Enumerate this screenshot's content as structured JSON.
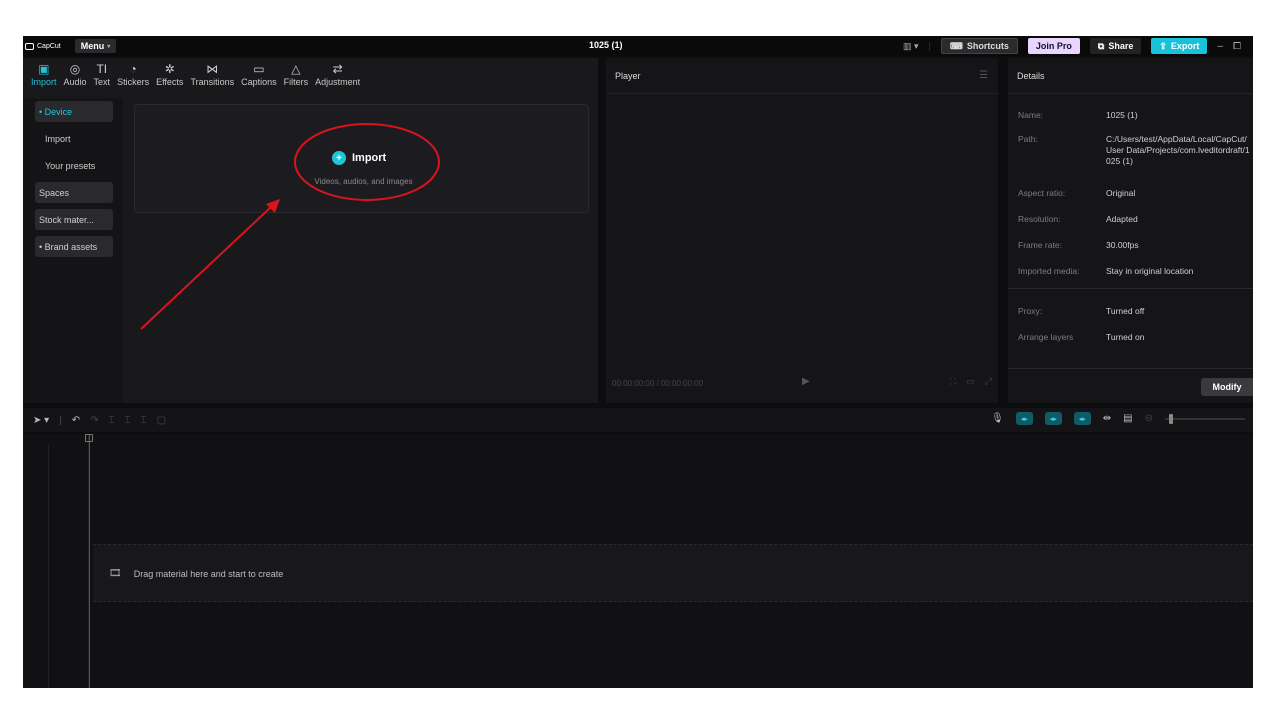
{
  "titlebar": {
    "logo": "CapCut",
    "menu": "Menu",
    "project_name": "1025 (1)",
    "shortcuts": "Shortcuts",
    "join_pro": "Join Pro",
    "share": "Share",
    "export": "Export"
  },
  "tabs": [
    {
      "label": "Import",
      "icon": "▣"
    },
    {
      "label": "Audio",
      "icon": "◎"
    },
    {
      "label": "Text",
      "icon": "TI"
    },
    {
      "label": "Stickers",
      "icon": "◔"
    },
    {
      "label": "Effects",
      "icon": "✲"
    },
    {
      "label": "Transitions",
      "icon": "⋈"
    },
    {
      "label": "Captions",
      "icon": "▭"
    },
    {
      "label": "Filters",
      "icon": "△"
    },
    {
      "label": "Adjustment",
      "icon": "⇄"
    }
  ],
  "sidebar": [
    {
      "label": "• Device"
    },
    {
      "label": "Import"
    },
    {
      "label": "Your presets"
    },
    {
      "label": "Spaces"
    },
    {
      "label": "Stock mater..."
    },
    {
      "label": "• Brand assets"
    }
  ],
  "import_zone": {
    "button": "Import",
    "subtitle": "Videos, audios, and images"
  },
  "player": {
    "title": "Player",
    "timecode": "00:00:00:00 / 00:00:00:00"
  },
  "details": {
    "title": "Details",
    "rows": [
      {
        "label": "Name:",
        "value": "1025 (1)"
      },
      {
        "label": "Path:",
        "value": "C:/Users/test/AppData/Local/CapCut/User Data/Projects/com.lveditordraft/1025 (1)"
      },
      {
        "label": "Aspect ratio:",
        "value": "Original"
      },
      {
        "label": "Resolution:",
        "value": "Adapted"
      },
      {
        "label": "Frame rate:",
        "value": "30.00fps"
      },
      {
        "label": "Imported media:",
        "value": "Stay in original location"
      },
      {
        "label": "Proxy:",
        "value": "Turned off"
      },
      {
        "label": "Arrange layers",
        "value": "Turned on"
      }
    ],
    "modify": "Modify"
  },
  "timeline": {
    "drop_hint": "Drag material here and start to create"
  },
  "colors": {
    "accent": "#23c4d9",
    "annotation": "#d9141c",
    "background": "#0d0d0f"
  }
}
